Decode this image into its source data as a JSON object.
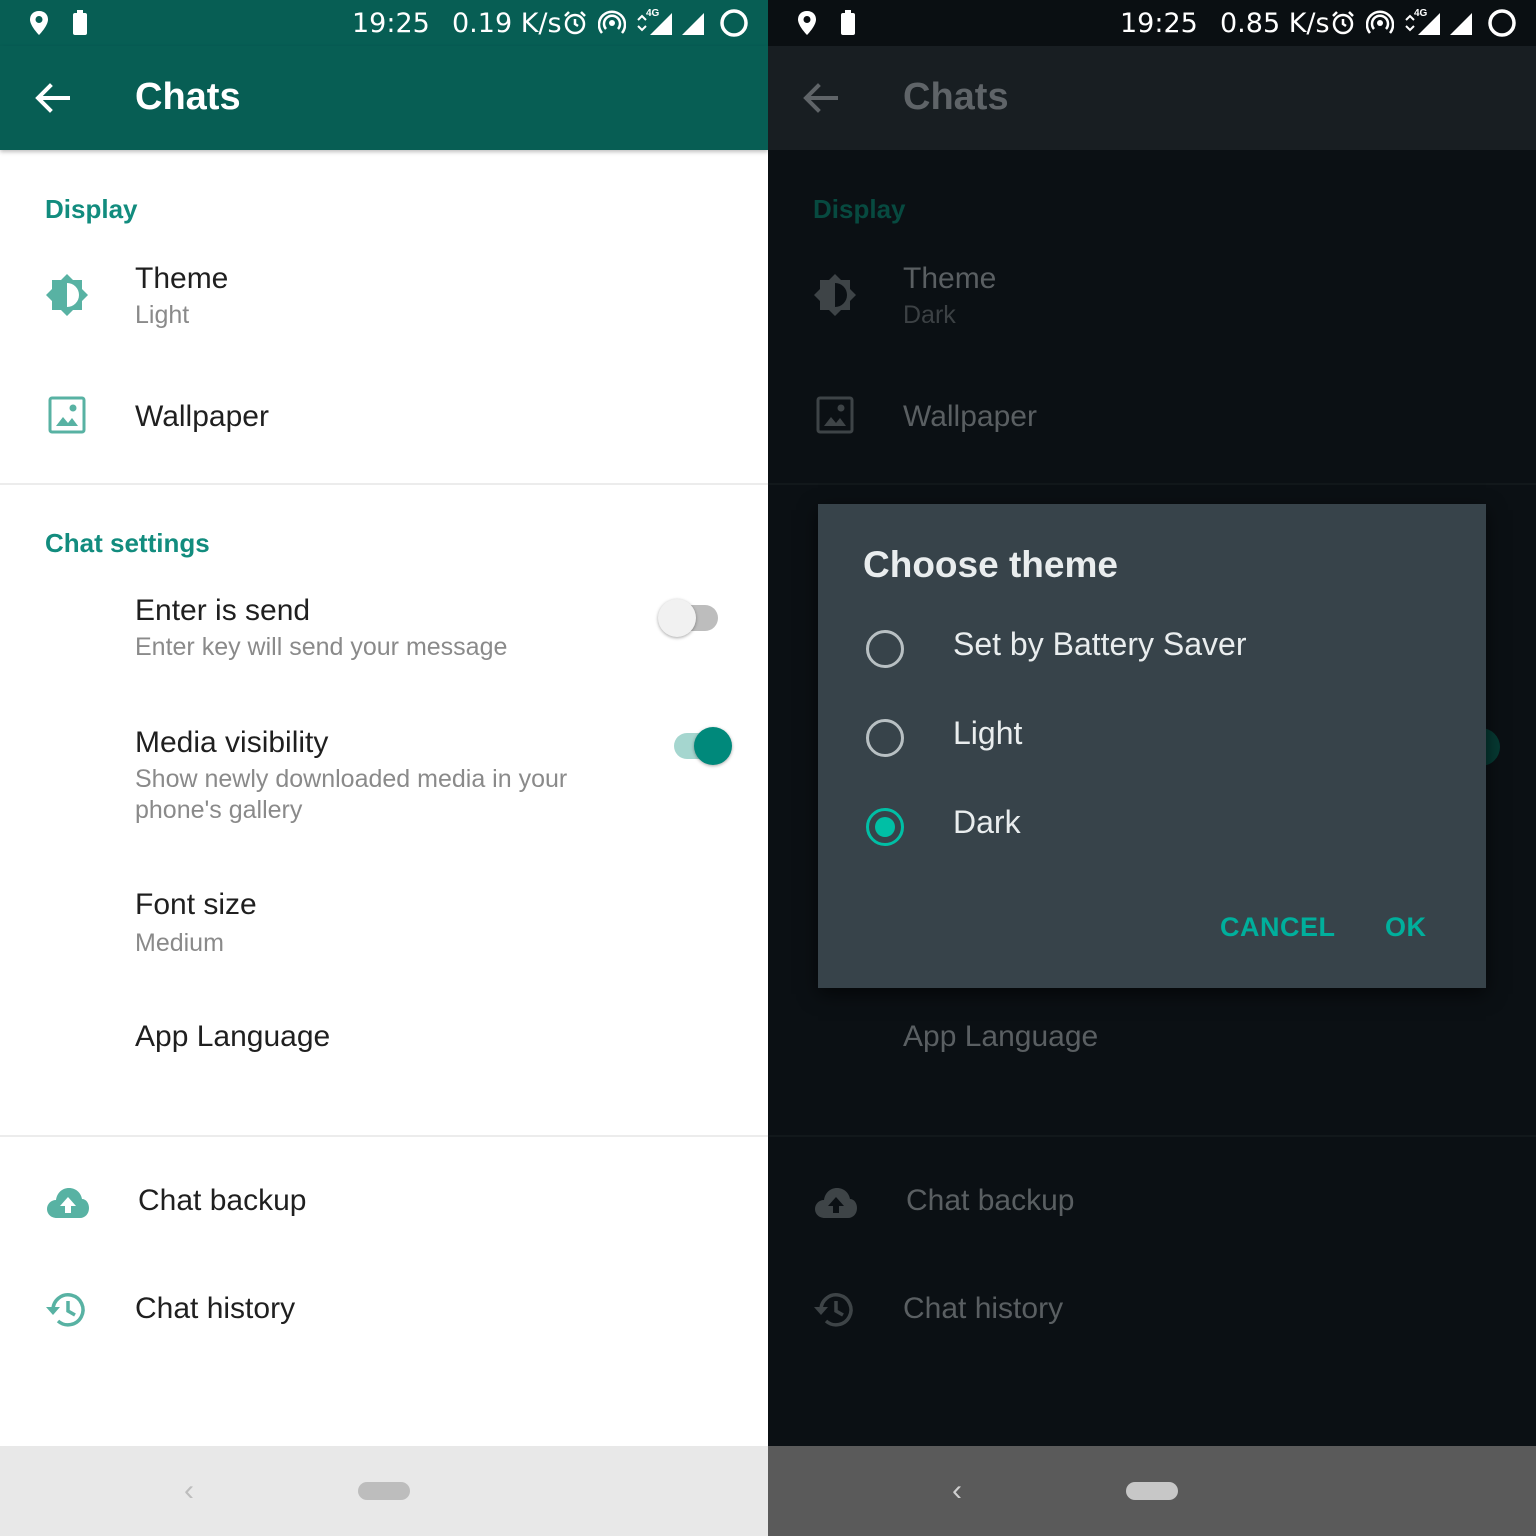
{
  "light": {
    "status": {
      "time": "19:25",
      "speed": "0.19 K/s",
      "network": "4G"
    },
    "appbar": {
      "title": "Chats"
    },
    "display": {
      "header": "Display",
      "theme": {
        "title": "Theme",
        "value": "Light"
      },
      "wallpaper": {
        "title": "Wallpaper"
      }
    },
    "chat_settings": {
      "header": "Chat settings",
      "enter_send": {
        "title": "Enter is send",
        "sub": "Enter key will send your message",
        "on": false
      },
      "media": {
        "title": "Media visibility",
        "sub": "Show newly downloaded media in your phone's gallery",
        "on": true
      },
      "font": {
        "title": "Font size",
        "value": "Medium"
      },
      "language": {
        "title": "App Language"
      }
    },
    "backup": {
      "title": "Chat backup"
    },
    "history": {
      "title": "Chat history"
    },
    "nav": {
      "back": "‹"
    }
  },
  "dark": {
    "status": {
      "time": "19:25",
      "speed": "0.85 K/s",
      "network": "4G"
    },
    "appbar": {
      "title": "Chats"
    },
    "display": {
      "header": "Display",
      "theme": {
        "title": "Theme",
        "value": "Dark"
      },
      "wallpaper": {
        "title": "Wallpaper"
      }
    },
    "chat_settings": {
      "language": {
        "title": "App Language"
      }
    },
    "backup": {
      "title": "Chat backup"
    },
    "history": {
      "title": "Chat history"
    },
    "nav": {
      "back": "‹"
    },
    "dialog": {
      "title": "Choose theme",
      "options": [
        {
          "label": "Set by Battery Saver",
          "checked": false
        },
        {
          "label": "Light",
          "checked": false
        },
        {
          "label": "Dark",
          "checked": true
        }
      ],
      "cancel": "CANCEL",
      "ok": "OK"
    }
  },
  "colors": {
    "whatsapp_teal": "#075e54",
    "accent_green": "#128c7e",
    "dialog_accent": "#00bfa5"
  }
}
